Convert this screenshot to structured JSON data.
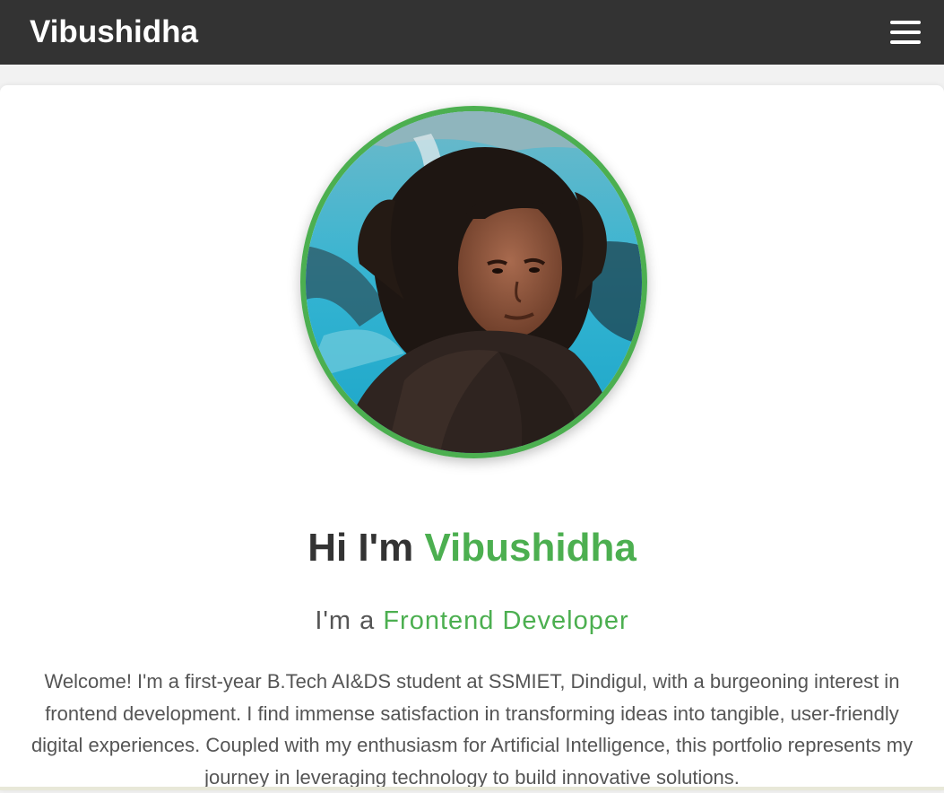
{
  "navbar": {
    "brand": "Vibushidha",
    "menu_icon": "hamburger-menu-icon"
  },
  "hero": {
    "avatar_alt": "Profile photo",
    "greeting_prefix": "Hi I'm ",
    "greeting_name": "Vibushidha",
    "role_prefix": "I'm a ",
    "role_title": "Frontend Developer",
    "bio": "Welcome! I'm a first-year B.Tech AI&DS student at SSMIET, Dindigul, with a burgeoning interest in frontend development. I find immense satisfaction in transforming ideas into tangible, user-friendly digital experiences. Coupled with my enthusiasm for Artificial Intelligence, this portfolio represents my journey in leveraging technology to build innovative solutions."
  },
  "colors": {
    "navbar_bg": "#333333",
    "accent": "#4caf50",
    "text": "#555555"
  }
}
